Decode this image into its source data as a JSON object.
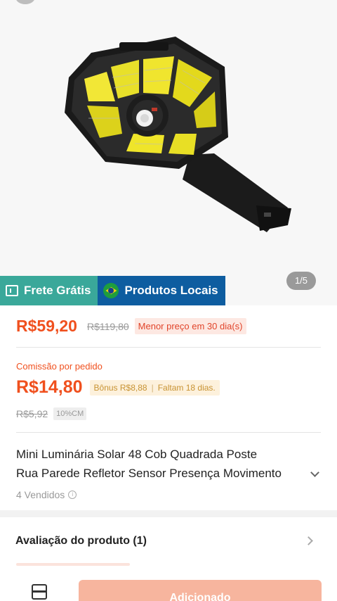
{
  "gallery": {
    "counter": "1/5"
  },
  "badges": {
    "shipping": "Frete Grátis",
    "local": "Produtos Locais"
  },
  "price": {
    "current": "R$59,20",
    "original": "R$119,80",
    "lowest_tag": "Menor preço em 30 dia(s)"
  },
  "commission": {
    "label": "Comissão por pedido",
    "value": "R$14,80",
    "bonus": "Bônus R$8,88",
    "remaining": "Faltam 18 dias.",
    "old_value": "R$5,92",
    "rate_tag": "10%CM"
  },
  "product": {
    "title_line1": "Mini Luminária Solar 48 Cob Quadrada Poste",
    "title_line2": "Rua Parede Refletor Sensor Presença Movimento",
    "sold": "4 Vendidos"
  },
  "reviews": {
    "title": "Avaliação do produto (1)"
  },
  "footer": {
    "add_button": "Adicionado"
  },
  "colors": {
    "accent": "#f0501e",
    "shipping_badge": "#3aa89a",
    "local_badge": "#0e5da0",
    "button": "#f7b59e"
  }
}
